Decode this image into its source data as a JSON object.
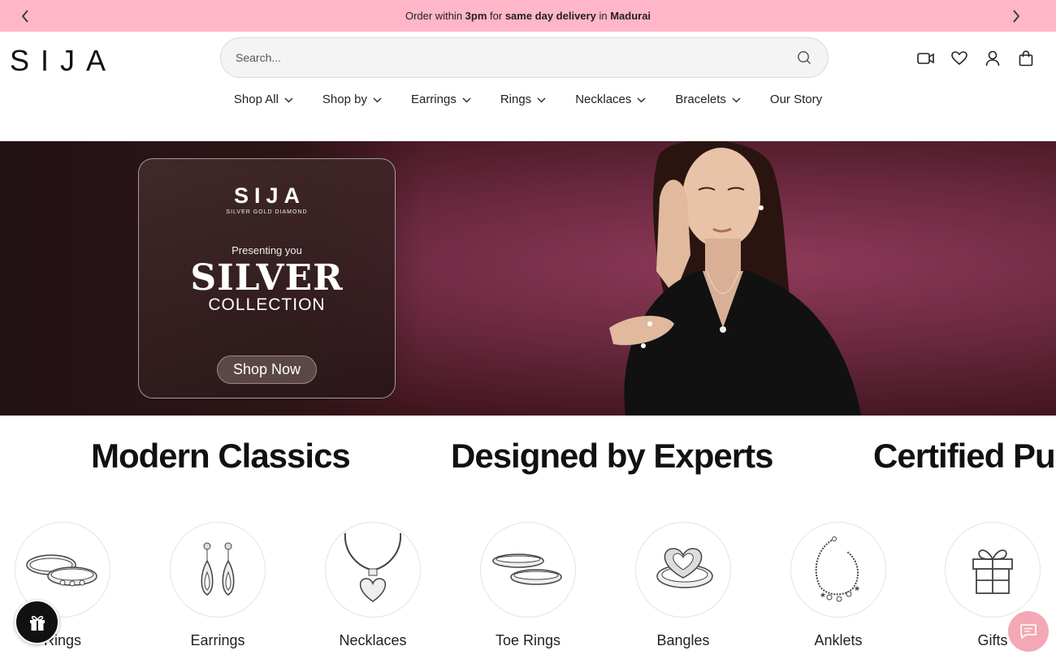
{
  "announcement": {
    "prefix": "Order within ",
    "time": "3pm",
    "middle": " for ",
    "highlight": "same day delivery",
    "in": " in ",
    "city": "Madurai"
  },
  "header": {
    "logo": "SIJA",
    "search_placeholder": "Search...",
    "icons": [
      "video-icon",
      "heart-icon",
      "user-icon",
      "bag-icon"
    ]
  },
  "nav": [
    {
      "label": "Shop All",
      "dropdown": true
    },
    {
      "label": "Shop by",
      "dropdown": true
    },
    {
      "label": "Earrings",
      "dropdown": true
    },
    {
      "label": "Rings",
      "dropdown": true
    },
    {
      "label": "Necklaces",
      "dropdown": true
    },
    {
      "label": "Bracelets",
      "dropdown": true
    },
    {
      "label": "Our Story",
      "dropdown": false
    }
  ],
  "hero": {
    "card_logo": "SIJA",
    "card_tagline": "SILVER  GOLD  DIAMOND",
    "presenting": "Presenting you",
    "headline": "SILVER",
    "subheadline": "COLLECTION",
    "cta": "Shop Now"
  },
  "marquee": [
    "Modern Classics",
    "Designed by Experts",
    "Certified Pu"
  ],
  "categories": [
    {
      "label": "Rings",
      "icon": "rings-icon"
    },
    {
      "label": "Earrings",
      "icon": "earrings-icon"
    },
    {
      "label": "Necklaces",
      "icon": "necklace-icon"
    },
    {
      "label": "Toe Rings",
      "icon": "toe-rings-icon"
    },
    {
      "label": "Bangles",
      "icon": "bangle-icon"
    },
    {
      "label": "Anklets",
      "icon": "anklet-icon"
    },
    {
      "label": "Gifts",
      "icon": "gift-box-icon"
    }
  ],
  "colors": {
    "announcement_bg": "#ffb6c8",
    "hero_bg": "#6e2a42",
    "chat_fab": "#f4a7b4"
  }
}
